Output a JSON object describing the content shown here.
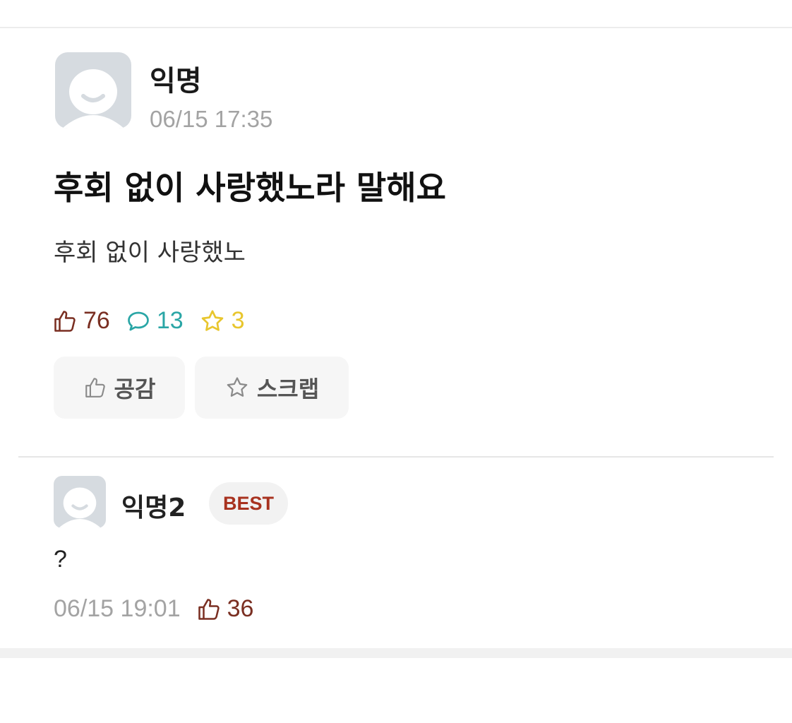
{
  "post": {
    "author": "익명",
    "time": "06/15 17:35",
    "title": "후회 없이 사랑했노라 말해요",
    "body": "후회 없이 사랑했노",
    "stats": {
      "likes": "76",
      "comments": "13",
      "scraps": "3"
    },
    "actions": {
      "like_label": "공감",
      "scrap_label": "스크랩"
    }
  },
  "comment": {
    "author": "익명2",
    "badge": "BEST",
    "text": "?",
    "time": "06/15 19:01",
    "likes": "36"
  },
  "colors": {
    "like": "#7a2f22",
    "comment": "#2aa6a6",
    "scrap": "#e8c62d",
    "badge_text": "#a8321f",
    "avatar_bg": "#d6dbe0"
  },
  "icons": {
    "like": "thumbs-up-icon",
    "comment": "speech-bubble-icon",
    "scrap": "star-icon",
    "avatar": "default-avatar-icon"
  }
}
